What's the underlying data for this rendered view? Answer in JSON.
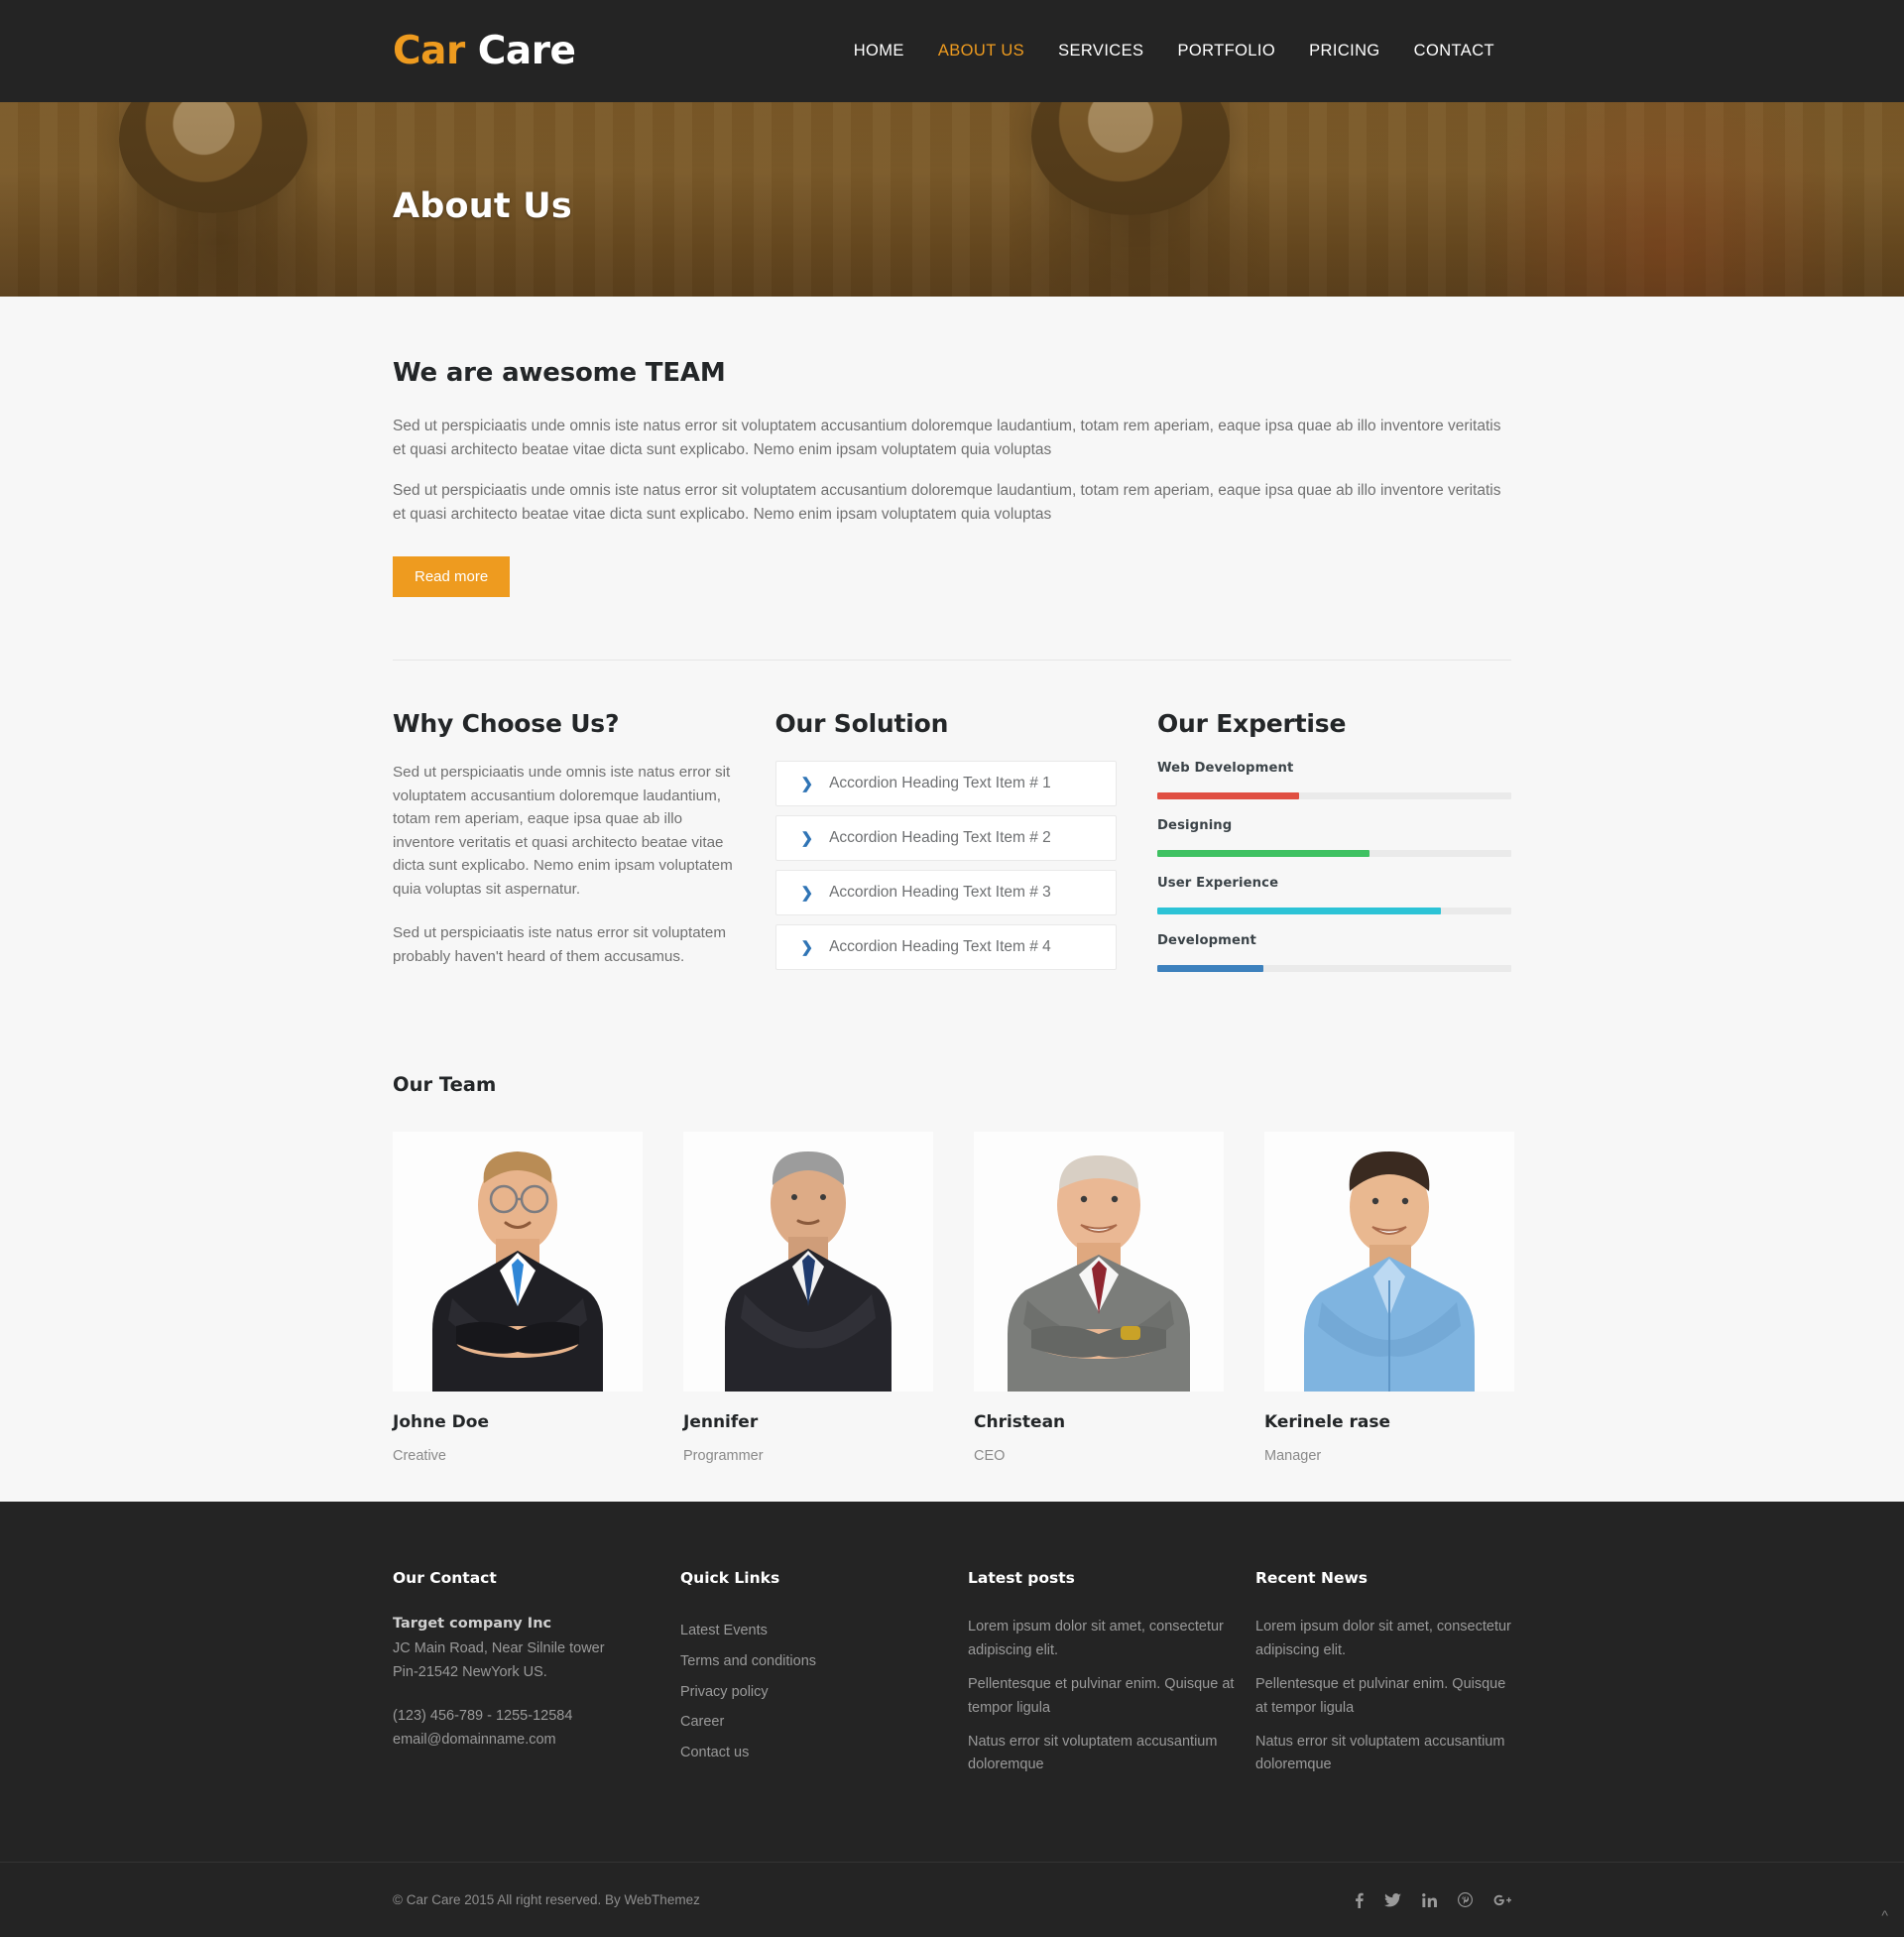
{
  "header": {
    "logo_accent": "Car",
    "logo_rest": "Care",
    "nav": [
      {
        "label": "HOME",
        "active": false
      },
      {
        "label": "ABOUT US",
        "active": true
      },
      {
        "label": "SERVICES",
        "active": false
      },
      {
        "label": "PORTFOLIO",
        "active": false
      },
      {
        "label": "PRICING",
        "active": false
      },
      {
        "label": "CONTACT",
        "active": false
      }
    ]
  },
  "banner": {
    "title": "About Us"
  },
  "intro": {
    "title": "We are awesome TEAM",
    "paragraph1": "Sed ut perspiciaatis unde omnis iste natus error sit voluptatem accusantium doloremque laudantium, totam rem aperiam, eaque ipsa quae ab illo inventore veritatis et quasi architecto beatae vitae dicta sunt explicabo. Nemo enim ipsam voluptatem quia voluptas",
    "paragraph2": "Sed ut perspiciaatis unde omnis iste natus error sit voluptatem accusantium doloremque laudantium, totam rem aperiam, eaque ipsa quae ab illo inventore veritatis et quasi architecto beatae vitae dicta sunt explicabo. Nemo enim ipsam voluptatem quia voluptas",
    "read_more": "Read more"
  },
  "why_choose": {
    "title": "Why Choose Us?",
    "paragraph1": "Sed ut perspiciaatis unde omnis iste natus error sit voluptatem accusantium doloremque laudantium, totam rem aperiam, eaque ipsa quae ab illo inventore veritatis et quasi architecto beatae vitae dicta sunt explicabo. Nemo enim ipsam voluptatem quia voluptas sit aspernatur.",
    "paragraph2": "Sed ut perspiciaatis iste natus error sit voluptatem probably haven't heard of them accusamus."
  },
  "our_solution": {
    "title": "Our Solution",
    "items": [
      {
        "label": "Accordion Heading Text Item # 1"
      },
      {
        "label": "Accordion Heading Text Item # 2"
      },
      {
        "label": "Accordion Heading Text Item # 3"
      },
      {
        "label": "Accordion Heading Text Item # 4"
      }
    ]
  },
  "our_expertise": {
    "title": "Our Expertise",
    "skills": [
      {
        "label": "Web Development",
        "percent": 40,
        "color": "#e04f42"
      },
      {
        "label": "Designing",
        "percent": 60,
        "color": "#3fc162"
      },
      {
        "label": "User Experience",
        "percent": 80,
        "color": "#2cc3d6"
      },
      {
        "label": "Development",
        "percent": 30,
        "color": "#3d81bd"
      }
    ]
  },
  "our_team": {
    "title": "Our Team",
    "members": [
      {
        "name": "Johne Doe",
        "role": "Creative"
      },
      {
        "name": "Jennifer",
        "role": "Programmer"
      },
      {
        "name": "Christean",
        "role": "CEO"
      },
      {
        "name": "Kerinele rase",
        "role": "Manager"
      }
    ]
  },
  "footer": {
    "contact": {
      "title": "Our Contact",
      "company": "Target company Inc",
      "address_line1": "JC Main Road, Near Silnile tower",
      "address_line2": "Pin-21542 NewYork US.",
      "phone": "(123) 456-789 - 1255-12584",
      "email": "email@domainname.com"
    },
    "quick_links": {
      "title": "Quick Links",
      "links": [
        "Latest Events",
        "Terms and conditions",
        "Privacy policy",
        "Career",
        "Contact us"
      ]
    },
    "latest_posts": {
      "title": "Latest posts",
      "posts": [
        "Lorem ipsum dolor sit amet, consectetur adipiscing elit.",
        "Pellentesque et pulvinar enim. Quisque at tempor ligula",
        "Natus error sit voluptatem accusantium doloremque"
      ]
    },
    "recent_news": {
      "title": "Recent News",
      "posts": [
        "Lorem ipsum dolor sit amet, consectetur adipiscing elit.",
        "Pellentesque et pulvinar enim. Quisque at tempor ligula",
        "Natus error sit voluptatem accusantium doloremque"
      ]
    },
    "copyright": "© Car Care 2015 All right reserved. By WebThemez",
    "socials": [
      {
        "name": "facebook-icon",
        "glyph": "f"
      },
      {
        "name": "twitter-icon",
        "glyph": "t"
      },
      {
        "name": "linkedin-icon",
        "glyph": "in"
      },
      {
        "name": "pinterest-icon",
        "glyph": "P"
      },
      {
        "name": "googleplus-icon",
        "glyph": "g+"
      }
    ],
    "scroll_top": "^"
  },
  "colors": {
    "brand_orange": "#ee9b1f",
    "dark": "#242424",
    "body_bg": "#f7f7f7",
    "accordion_chevron": "#2f74b5"
  }
}
